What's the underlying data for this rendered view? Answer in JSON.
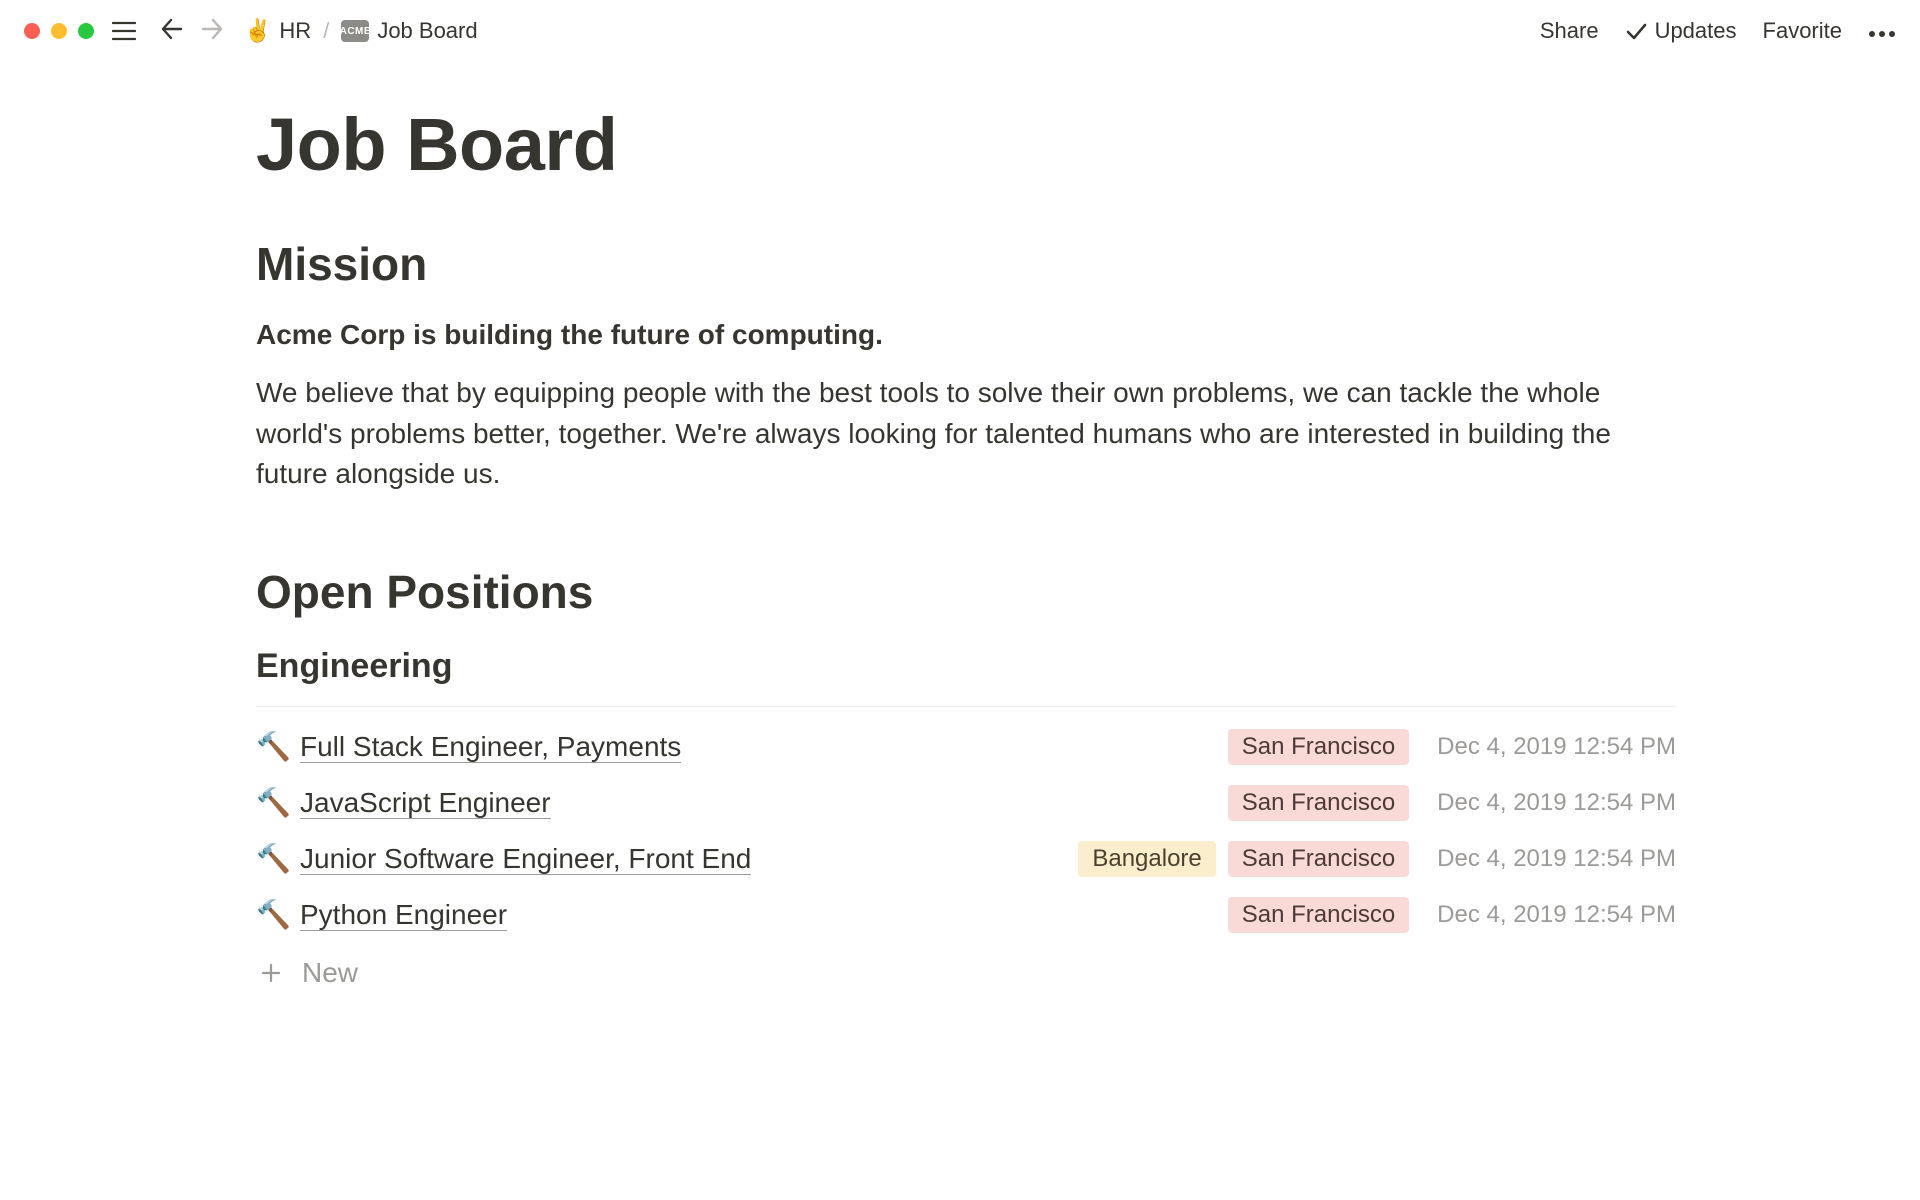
{
  "topbar": {
    "breadcrumb": [
      {
        "emoji": "✌️",
        "label": "HR"
      },
      {
        "badge": "ACME",
        "label": "Job Board"
      }
    ],
    "actions": {
      "share": "Share",
      "updates": "Updates",
      "favorite": "Favorite"
    }
  },
  "page": {
    "title": "Job Board",
    "mission": {
      "heading": "Mission",
      "lead": "Acme Corp is building the future of computing.",
      "body": "We believe that by equipping people with the best tools to solve their own problems, we can tackle the whole world's problems better, together. We're always looking for talented humans who are interested in building the future alongside us."
    },
    "positions": {
      "heading": "Open Positions",
      "groups": [
        {
          "group_name": "Engineering",
          "jobs": [
            {
              "icon": "🔨",
              "title": "Full Stack Engineer, Payments",
              "tags": [
                "San Francisco"
              ],
              "date": "Dec 4, 2019 12:54 PM"
            },
            {
              "icon": "🔨",
              "title": "JavaScript Engineer",
              "tags": [
                "San Francisco"
              ],
              "date": "Dec 4, 2019 12:54 PM"
            },
            {
              "icon": "🔨",
              "title": "Junior Software Engineer, Front End",
              "tags": [
                "Bangalore",
                "San Francisco"
              ],
              "date": "Dec 4, 2019 12:54 PM"
            },
            {
              "icon": "🔨",
              "title": "Python Engineer",
              "tags": [
                "San Francisco"
              ],
              "date": "Dec 4, 2019 12:54 PM"
            }
          ]
        }
      ],
      "new_label": "New"
    }
  },
  "tag_colors": {
    "San Francisco": "tag-sf",
    "Bangalore": "tag-blr"
  }
}
